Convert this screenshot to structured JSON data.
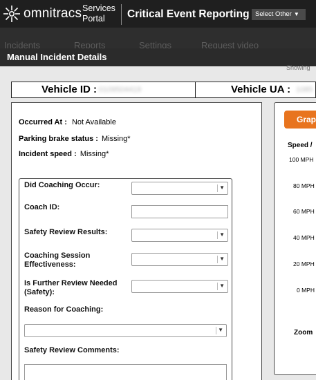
{
  "header": {
    "brand": "omnitracs",
    "portal_line1": "Services",
    "portal_line2": "Portal",
    "app_title": "Critical Event Reporting",
    "select_other": "Select Other"
  },
  "background": {
    "nav": [
      "Incidents",
      "Reports",
      "Settings",
      "Request video"
    ],
    "showing": "Showing"
  },
  "modal": {
    "title": "Manual Incident Details",
    "vehicle_id_label": "Vehicle ID :",
    "vehicle_id_value": "0109504419",
    "vehicle_ua_label": "Vehicle UA :",
    "vehicle_ua_value": "1085"
  },
  "details": {
    "occurred_label": "Occurred At :",
    "occurred_value": "Not Available",
    "brake_label": "Parking brake status :",
    "brake_value": "Missing*",
    "speed_label": "Incident speed :",
    "speed_value": "Missing*"
  },
  "form": {
    "coaching_occur": "Did Coaching Occur:",
    "coach_id": "Coach ID:",
    "safety_results": "Safety Review Results:",
    "effectiveness_line1": "Coaching Session",
    "effectiveness_line2": "Effectiveness:",
    "further_line1": "Is Further Review Needed",
    "further_line2": "(Safety):",
    "reason": "Reason for Coaching:",
    "comments": "Safety Review Comments:"
  },
  "graph": {
    "button": "Grap",
    "speed_label": "Speed /",
    "ticks": [
      "100 MPH",
      "80 MPH",
      "60 MPH",
      "40 MPH",
      "20 MPH",
      "0 MPH"
    ],
    "zoom": "Zoom"
  },
  "colors": {
    "accent_orange": "#e8741e",
    "header_bg": "#1f1f1f"
  }
}
